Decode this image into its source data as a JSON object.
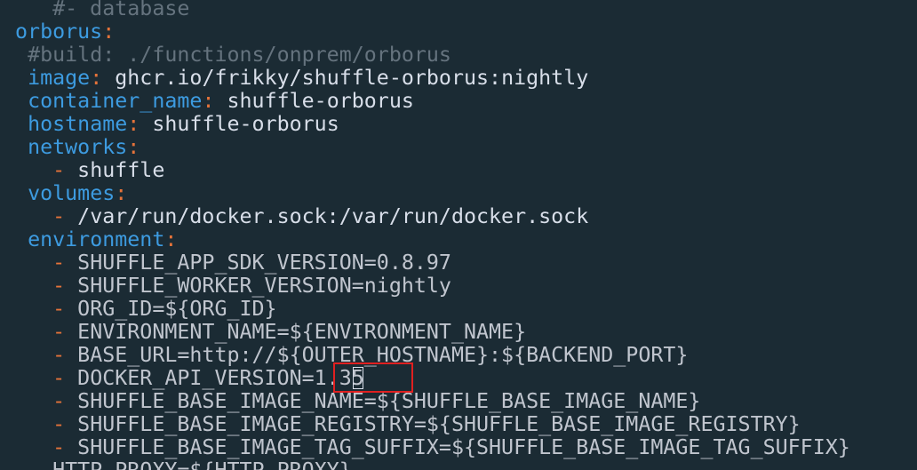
{
  "lines": [
    {
      "indent": "    ",
      "dash": "",
      "key": "",
      "colon": "",
      "value": "",
      "comment": "#- database",
      "env": ""
    },
    {
      "indent": " ",
      "dash": "",
      "key": "orborus",
      "colon": ":",
      "value": "",
      "comment": "",
      "env": ""
    },
    {
      "indent": "  ",
      "dash": "",
      "key": "",
      "colon": "",
      "value": "",
      "comment": "#build: ./functions/onprem/orborus",
      "env": ""
    },
    {
      "indent": "  ",
      "dash": "",
      "key": "image",
      "colon": ":",
      "value": " ghcr.io/frikky/shuffle-orborus:nightly",
      "comment": "",
      "env": ""
    },
    {
      "indent": "  ",
      "dash": "",
      "key": "container_name",
      "colon": ":",
      "value": " shuffle-orborus",
      "comment": "",
      "env": ""
    },
    {
      "indent": "  ",
      "dash": "",
      "key": "hostname",
      "colon": ":",
      "value": " shuffle-orborus",
      "comment": "",
      "env": ""
    },
    {
      "indent": "  ",
      "dash": "",
      "key": "networks",
      "colon": ":",
      "value": "",
      "comment": "",
      "env": ""
    },
    {
      "indent": "    ",
      "dash": "-",
      "key": "",
      "colon": "",
      "value": " shuffle",
      "comment": "",
      "env": ""
    },
    {
      "indent": "  ",
      "dash": "",
      "key": "volumes",
      "colon": ":",
      "value": "",
      "comment": "",
      "env": ""
    },
    {
      "indent": "    ",
      "dash": "-",
      "key": "",
      "colon": "",
      "value": " /var/run/docker.sock:/var/run/docker.sock",
      "comment": "",
      "env": ""
    },
    {
      "indent": "  ",
      "dash": "",
      "key": "environment",
      "colon": ":",
      "value": "",
      "comment": "",
      "env": ""
    },
    {
      "indent": "    ",
      "dash": "-",
      "key": "",
      "colon": "",
      "value": "",
      "comment": "",
      "env": " SHUFFLE_APP_SDK_VERSION=0.8.97"
    },
    {
      "indent": "    ",
      "dash": "-",
      "key": "",
      "colon": "",
      "value": "",
      "comment": "",
      "env": " SHUFFLE_WORKER_VERSION=nightly"
    },
    {
      "indent": "    ",
      "dash": "-",
      "key": "",
      "colon": "",
      "value": "",
      "comment": "",
      "env": " ORG_ID=${ORG_ID}"
    },
    {
      "indent": "    ",
      "dash": "-",
      "key": "",
      "colon": "",
      "value": "",
      "comment": "",
      "env": " ENVIRONMENT_NAME=${ENVIRONMENT_NAME}"
    },
    {
      "indent": "    ",
      "dash": "-",
      "key": "",
      "colon": "",
      "value": "",
      "comment": "",
      "env": " BASE_URL=http://${OUTER_HOSTNAME}:${BACKEND_PORT}"
    },
    {
      "indent": "    ",
      "dash": "-",
      "key": "",
      "colon": "",
      "value": "",
      "comment": "",
      "env": " DOCKER_API_VERSION=1.35"
    },
    {
      "indent": "    ",
      "dash": "-",
      "key": "",
      "colon": "",
      "value": "",
      "comment": "",
      "env": " SHUFFLE_BASE_IMAGE_NAME=${SHUFFLE_BASE_IMAGE_NAME}"
    },
    {
      "indent": "    ",
      "dash": "-",
      "key": "",
      "colon": "",
      "value": "",
      "comment": "",
      "env": " SHUFFLE_BASE_IMAGE_REGISTRY=${SHUFFLE_BASE_IMAGE_REGISTRY}"
    },
    {
      "indent": "    ",
      "dash": "-",
      "key": "",
      "colon": "",
      "value": "",
      "comment": "",
      "env": " SHUFFLE_BASE_IMAGE_TAG_SUFFIX=${SHUFFLE_BASE_IMAGE_TAG_SUFFIX}"
    },
    {
      "indent": "    ",
      "dash": "",
      "key": "",
      "colon": "",
      "value": "",
      "comment": "",
      "env": "HTTP_PROXY=${HTTP_PROXY}"
    }
  ],
  "cursor": {
    "line_index": 16,
    "before": " DOCKER_API_VERSION=1.3",
    "char": "5",
    "after": ""
  },
  "colors": {
    "background": "#1b2b34",
    "key": "#3d9be0",
    "punctuation": "#e5733a",
    "comment": "#65737e",
    "text": "#d8dee9",
    "highlight_box": "#e02020"
  }
}
